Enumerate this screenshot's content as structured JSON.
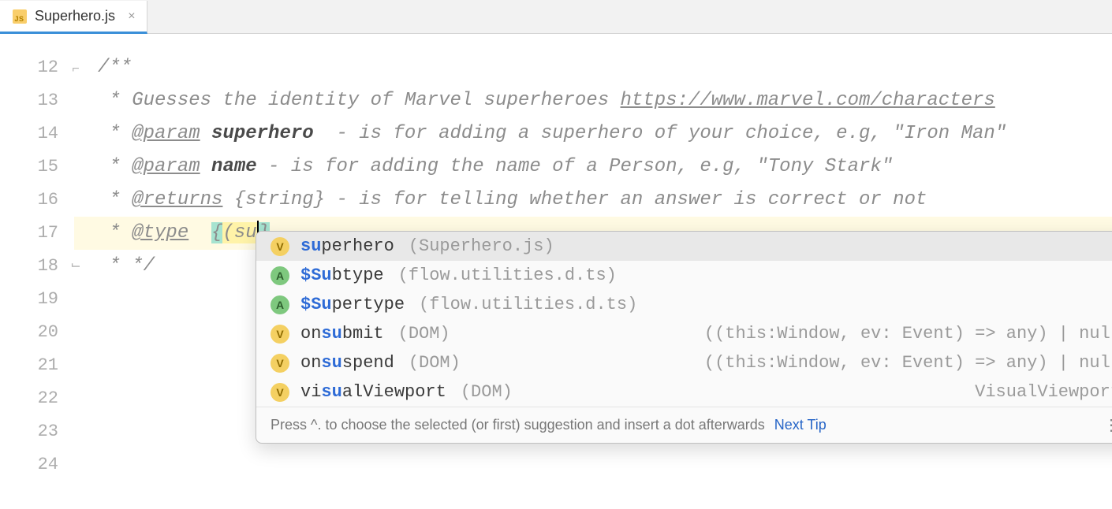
{
  "tab": {
    "filename": "Superhero.js"
  },
  "gutter": {
    "start": 12,
    "end": 24
  },
  "code": {
    "l12": "/**",
    "l13_pre": " * Guesses the identity of Marvel superheroes ",
    "l13_link": "https://www.marvel.com/characters",
    "l14_pre": " * ",
    "l14_tag": "@param",
    "l14_name": " superhero",
    "l14_rest": "  - is for adding a superhero of your choice, e.g, \"Iron Man\"",
    "l15_pre": " * ",
    "l15_tag": "@param",
    "l15_name": " name",
    "l15_rest": " - is for adding the name of a Person, e.g, \"Tony Stark\"",
    "l16_pre": " * ",
    "l16_tag": "@returns",
    "l16_rest": " {string} - is for telling whether an answer is correct or not",
    "l17_pre": " * ",
    "l17_tag": "@type",
    "l17_sp": "  ",
    "l17_brace_open": "{",
    "l17_paren": "(",
    "l17_typed": "su",
    "l17_brace_close": "}",
    "l18": " * */"
  },
  "completion": {
    "items": [
      {
        "icon": "V",
        "iconClass": "v",
        "prefix": "su",
        "rest": "perhero",
        "loc": "(Superhero.js)",
        "type": "",
        "selected": true
      },
      {
        "icon": "A",
        "iconClass": "a",
        "prefix": "$Su",
        "rest": "btype",
        "loc": "(flow.utilities.d.ts)",
        "type": ""
      },
      {
        "icon": "A",
        "iconClass": "a",
        "prefix": "$Su",
        "rest": "pertype",
        "loc": "(flow.utilities.d.ts)",
        "type": ""
      },
      {
        "icon": "V",
        "iconClass": "v",
        "prefix": "on",
        "match": "su",
        "rest": "bmit",
        "loc": "(DOM)",
        "type": "((this:Window, ev: Event) => any) | null"
      },
      {
        "icon": "V",
        "iconClass": "v",
        "prefix": "on",
        "match": "su",
        "rest": "spend",
        "loc": "(DOM)",
        "type": "((this:Window, ev: Event) => any) | null"
      },
      {
        "icon": "V",
        "iconClass": "v",
        "prefix": "vi",
        "match": "su",
        "rest": "alViewport",
        "loc": "(DOM)",
        "type": "VisualViewport"
      }
    ],
    "footer_hint": "Press ^. to choose the selected (or first) suggestion and insert a dot afterwards",
    "footer_link": "Next Tip"
  }
}
